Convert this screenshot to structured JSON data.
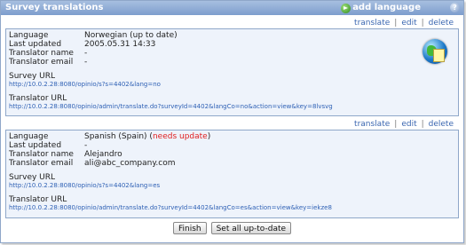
{
  "window": {
    "title": "Survey translations",
    "add_language_label": "add language",
    "help_symbol": "?"
  },
  "link_separator": "|",
  "translations": [
    {
      "actions": {
        "translate": "translate",
        "edit": "edit",
        "delete": "delete"
      },
      "fields": {
        "language_label": "Language",
        "language_value": "Norwegian (up to date)",
        "language_status": "",
        "updated_label": "Last updated",
        "updated_value": "2005.05.31 14:33",
        "translator_name_label": "Translator name",
        "translator_name_value": "-",
        "translator_email_label": "Translator email",
        "translator_email_value": "-"
      },
      "survey_url_label": "Survey URL",
      "survey_url": "http://10.0.2.28:8080/opinio/s?s=4402&lang=no",
      "translator_url_label": "Translator URL",
      "translator_url": "http://10.0.2.28:8080/opinio/admin/translate.do?surveyId=4402&langCo=no&action=view&key=8lvsvg"
    },
    {
      "actions": {
        "translate": "translate",
        "edit": "edit",
        "delete": "delete"
      },
      "fields": {
        "language_label": "Language",
        "language_value": "Spanish (Spain) (",
        "language_status": "needs update",
        "language_close": ")",
        "updated_label": "Last updated",
        "updated_value": "-",
        "translator_name_label": "Translator name",
        "translator_name_value": "Alejandro",
        "translator_email_label": "Translator email",
        "translator_email_value": "ali@abc_company.com"
      },
      "survey_url_label": "Survey URL",
      "survey_url": "http://10.0.2.28:8080/opinio/s?s=4402&lang=es",
      "translator_url_label": "Translator URL",
      "translator_url": "http://10.0.2.28:8080/opinio/admin/translate.do?surveyId=4402&langCo=es&action=view&key=iekze8"
    }
  ],
  "buttons": {
    "finish": "Finish",
    "set_all": "Set all up-to-date"
  },
  "icons": {
    "add_language": "green-arrow-icon",
    "help": "help-icon",
    "globe": "globe-icon"
  },
  "colors": {
    "titlebar": "#7d9dcd",
    "link": "#3a66b0",
    "needs_update": "#e02020"
  }
}
